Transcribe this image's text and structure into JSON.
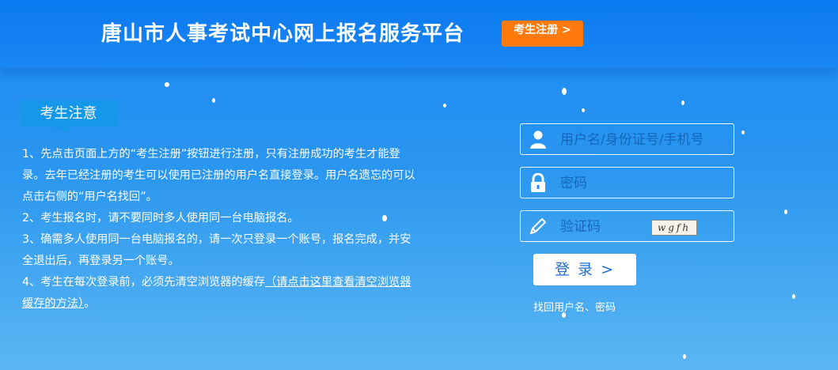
{
  "header": {
    "title": "唐山市人事考试中心网上报名服务平台",
    "register_button": "考生注册 >"
  },
  "notice": {
    "tab": "考生注意",
    "items": [
      "1、先点击页面上方的“考生注册”按钮进行注册，只有注册成功的考生才能登录。去年已经注册的考生可以使用已注册的用户名直接登录。用户名遗忘的可以点击右侧的“用户名找回”。",
      "2、考生报名时，请不要同时多人使用同一台电脑报名。",
      "3、确需多人使用同一台电脑报名的，请一次只登录一个账号，报名完成，并安全退出后，再登录另一个账号。"
    ],
    "item4_text": "4、考生在每次登录前，必须先清空浏览器的缓存",
    "item4_link": "（请点击这里查看清空浏览器缓存的方法）",
    "item4_end": "。"
  },
  "login": {
    "username_placeholder": "用户名/身份证号/手机号",
    "password_placeholder": "密码",
    "captcha_placeholder": "验证码",
    "captcha_text": "wgfh",
    "login_button": "登 录 >",
    "recover_link": "找回用户名、密码"
  },
  "colors": {
    "header": "#0b79f0",
    "background": "#2a96f0",
    "register_button": "#ff7a0d",
    "login_text": "#1f6fd0"
  }
}
